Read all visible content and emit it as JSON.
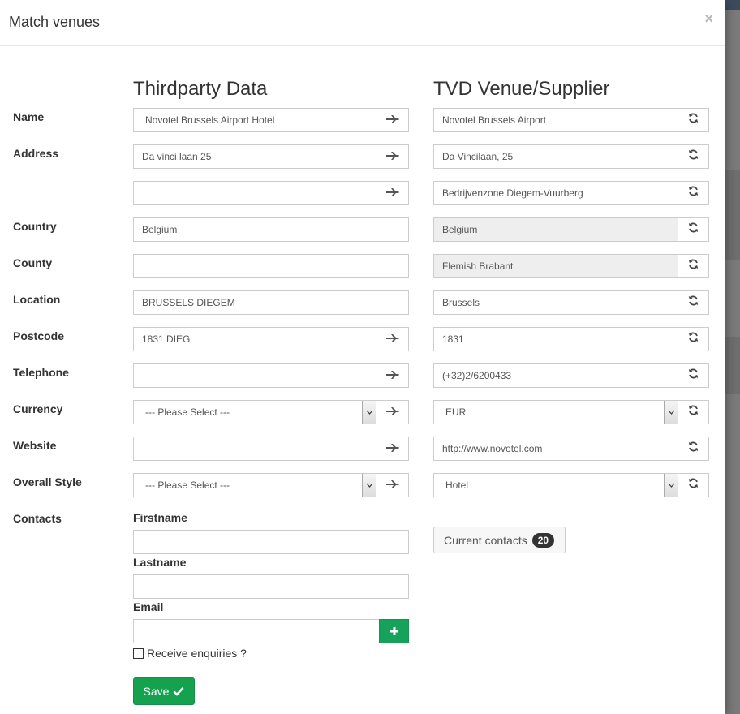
{
  "modal": {
    "title": "Match venues",
    "close": "×"
  },
  "columns": {
    "left": "Thirdparty Data",
    "right": "TVD Venue/Supplier"
  },
  "labels": {
    "name": "Name",
    "address": "Address",
    "country": "Country",
    "county": "County",
    "location": "Location",
    "postcode": "Postcode",
    "telephone": "Telephone",
    "currency": "Currency",
    "website": "Website",
    "overall_style": "Overall Style",
    "contacts": "Contacts"
  },
  "left": {
    "name": "Novotel Brussels Airport Hotel",
    "address1": "Da vinci laan 25",
    "address2": "",
    "country": "Belgium",
    "county": "",
    "location": "BRUSSELS DIEGEM",
    "postcode": "1831  DIEG",
    "telephone": "",
    "currency": "--- Please Select ---",
    "website": "",
    "overall_style": "--- Please Select ---"
  },
  "right": {
    "name": "Novotel Brussels Airport",
    "address1": "Da Vincilaan, 25",
    "address2": "Bedrijvenzone Diegem-Vuurberg",
    "country": "Belgium",
    "county": "Flemish Brabant",
    "location": "Brussels",
    "postcode": "1831",
    "telephone": "(+32)2/6200433",
    "currency": "EUR",
    "website": "http://www.novotel.com",
    "overall_style": "Hotel"
  },
  "contacts_form": {
    "firstname_label": "Firstname",
    "lastname_label": "Lastname",
    "email_label": "Email",
    "firstname": "",
    "lastname": "",
    "email": "",
    "receive_enquiries": "Receive enquiries ?",
    "receive_checked": false
  },
  "current_contacts": {
    "label": "Current contacts",
    "count": "20"
  },
  "save": {
    "label": "Save"
  },
  "icons": {
    "transfer": "plane-arrow-icon",
    "refresh": "refresh-icon",
    "plus": "plus-icon",
    "check": "check-icon"
  },
  "colors": {
    "accent_green": "#16a25a",
    "readonly_bg": "#eeeeee"
  }
}
